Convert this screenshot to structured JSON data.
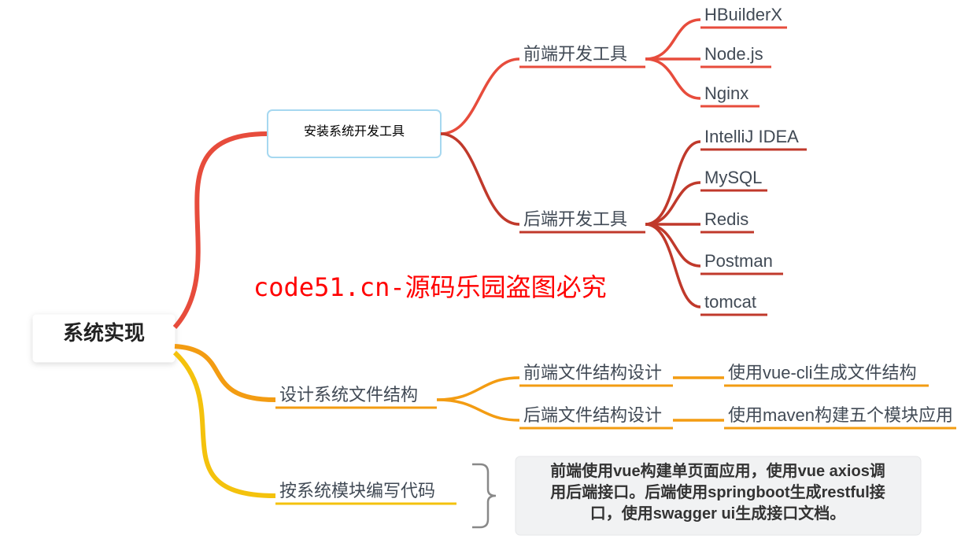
{
  "root": {
    "label": "系统实现"
  },
  "branches": [
    {
      "id": "install",
      "label": "安装系统开发工具",
      "color": "red",
      "children": [
        {
          "id": "frontend-tools",
          "label": "前端开发工具",
          "color": "red",
          "children": [
            {
              "id": "hbuilderx",
              "label": "HBuilderX",
              "color": "red"
            },
            {
              "id": "nodejs",
              "label": "Node.js",
              "color": "red"
            },
            {
              "id": "nginx",
              "label": "Nginx",
              "color": "red"
            }
          ]
        },
        {
          "id": "backend-tools",
          "label": "后端开发工具",
          "color": "red-dark",
          "children": [
            {
              "id": "intellij",
              "label": "IntelliJ IDEA",
              "color": "red-dark"
            },
            {
              "id": "mysql",
              "label": "MySQL",
              "color": "red-dark"
            },
            {
              "id": "redis",
              "label": "Redis",
              "color": "red-dark"
            },
            {
              "id": "postman",
              "label": "Postman",
              "color": "red-dark"
            },
            {
              "id": "tomcat",
              "label": "tomcat",
              "color": "red-dark"
            }
          ]
        }
      ]
    },
    {
      "id": "design-files",
      "label": "设计系统文件结构",
      "color": "orange",
      "children": [
        {
          "id": "fe-structure",
          "label": "前端文件结构设计",
          "color": "orange",
          "children": [
            {
              "id": "vue-cli",
              "label": "使用vue-cli生成文件结构",
              "color": "orange"
            }
          ]
        },
        {
          "id": "be-structure",
          "label": "后端文件结构设计",
          "color": "orange",
          "children": [
            {
              "id": "maven",
              "label": "使用maven构建五个模块应用",
              "color": "orange"
            }
          ]
        }
      ]
    },
    {
      "id": "write-code",
      "label": "按系统模块编写代码",
      "color": "yellow",
      "summary": {
        "lines": [
          "前端使用vue构建单页面应用，使用vue axios调",
          "用后端接口。后端使用springboot生成restful接",
          "口，使用swagger ui生成接口文档。"
        ]
      }
    }
  ],
  "watermark": "code51.cn-源码乐园盗图必究"
}
